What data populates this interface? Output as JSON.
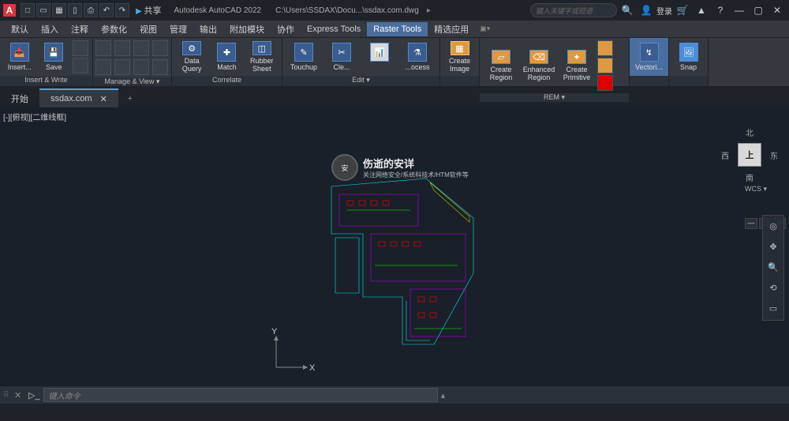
{
  "app": {
    "name": "Autodesk AutoCAD 2022",
    "path": "C:\\Users\\SSDAX\\Docu...\\ssdax.com.dwg",
    "logo": "A"
  },
  "qat": [
    "□",
    "▭",
    "▦",
    "▯",
    "⎙",
    "↶",
    "↷"
  ],
  "share": "共享",
  "search_placeholder": "键入关键字或短语",
  "login": "登录",
  "menus": [
    "默认",
    "插入",
    "注释",
    "参数化",
    "视图",
    "管理",
    "输出",
    "附加模块",
    "协作",
    "Express Tools",
    "Raster Tools",
    "精选应用"
  ],
  "active_menu": 10,
  "ribbon_panels": [
    {
      "title": "Insert & Write",
      "big": [
        {
          "label": "Insert..."
        },
        {
          "label": "Save"
        }
      ],
      "small": 3
    },
    {
      "title": "Manage & View ▾",
      "big": [],
      "small": 10
    },
    {
      "title": "Correlate",
      "big": [
        {
          "label": "Data\nQuery"
        },
        {
          "label": "Match"
        },
        {
          "label": "Rubber\nSheet"
        }
      ],
      "small": 0
    },
    {
      "title": "Edit ▾",
      "big": [
        {
          "label": "Touchup"
        },
        {
          "label": "Cle..."
        },
        {
          "label": "...ocess"
        }
      ],
      "small": 0
    },
    {
      "title": "",
      "big": [
        {
          "label": "Create\nImage"
        }
      ],
      "small": 0
    },
    {
      "title": "REM ▾",
      "big": [
        {
          "label": "Create\nRegion"
        },
        {
          "label": "Enhanced\nRegion"
        },
        {
          "label": "Create\nPrimitive"
        }
      ],
      "small": 3
    },
    {
      "title": "",
      "big": [
        {
          "label": "Vectori..."
        }
      ],
      "small": 0
    },
    {
      "title": "",
      "big": [
        {
          "label": "Snap"
        }
      ],
      "small": 0
    }
  ],
  "tabs": [
    {
      "label": "开始",
      "active": false
    },
    {
      "label": "ssdax.com",
      "active": true
    }
  ],
  "view_label": "[-][俯视][二维线框]",
  "viewcube": {
    "face": "上",
    "n": "北",
    "s": "南",
    "e": "东",
    "w": "西",
    "wcs": "WCS ▾"
  },
  "ucs": {
    "x": "X",
    "y": "Y"
  },
  "cmd_placeholder": "键入命令",
  "watermark": {
    "title": "伤逝的安详",
    "sub": "关注网络安全/系统科技术/HTM软件等"
  }
}
